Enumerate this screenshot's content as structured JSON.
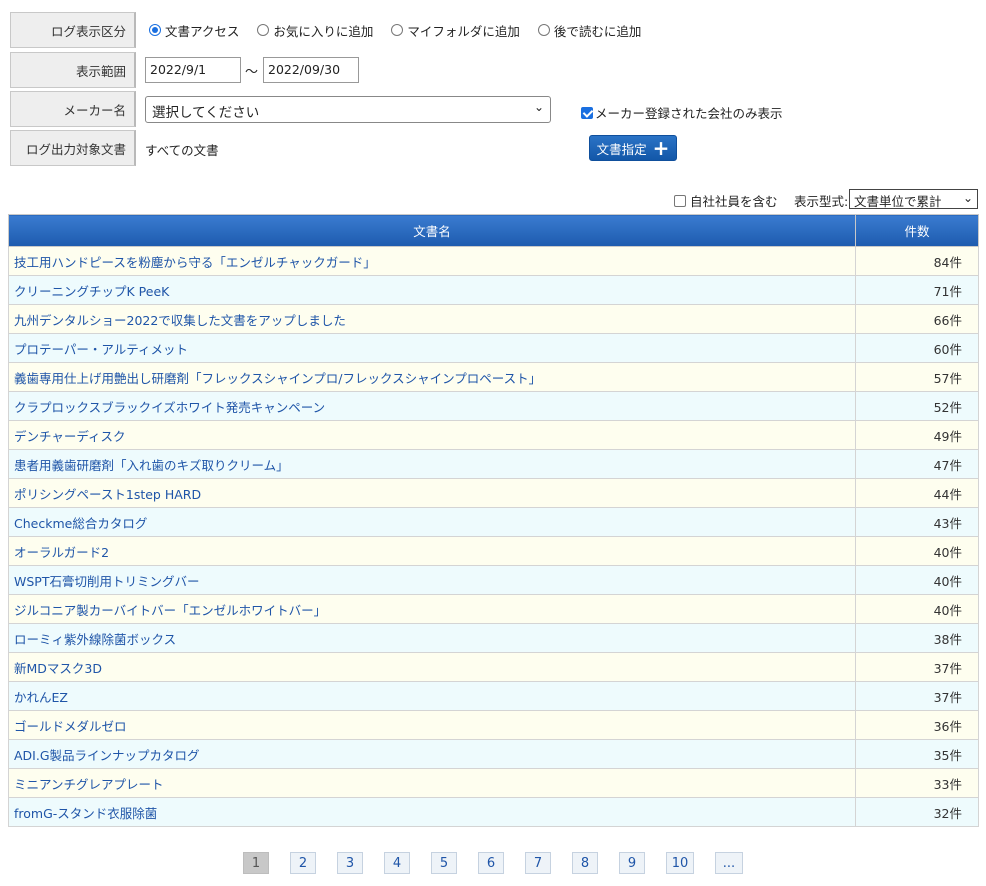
{
  "filters": {
    "log_type": {
      "label": "ログ表示区分",
      "options": [
        "文書アクセス",
        "お気に入りに追加",
        "マイフォルダに追加",
        "後で読むに追加"
      ],
      "selected": "文書アクセス"
    },
    "range": {
      "label": "表示範囲",
      "from": "2022/9/1",
      "separator": "～",
      "to": "2022/09/30"
    },
    "maker": {
      "label": "メーカー名",
      "value": "選択してください",
      "registered_only_label": "メーカー登録された会社のみ表示",
      "registered_only_checked": true
    },
    "target_docs": {
      "label": "ログ出力対象文書",
      "value": "すべての文書",
      "button_label": "文書指定"
    }
  },
  "options": {
    "include_staff_label": "自社社員を含む",
    "include_staff_checked": false,
    "display_type_label": "表示型式:",
    "display_type_value": "文書単位で累計"
  },
  "table": {
    "headers": [
      "文書名",
      "件数"
    ],
    "rows": [
      {
        "name": "技工用ハンドピースを粉塵から守る「エンゼルチャックガード」",
        "count": "84件"
      },
      {
        "name": "クリーニングチップK PeeK",
        "count": "71件"
      },
      {
        "name": "九州デンタルショー2022で収集した文書をアップしました",
        "count": "66件"
      },
      {
        "name": "プロテーパー・アルティメット",
        "count": "60件"
      },
      {
        "name": "義歯専用仕上げ用艶出し研磨剤「フレックスシャインプロ/フレックスシャインプロペースト」",
        "count": "57件"
      },
      {
        "name": "クラプロックスブラックイズホワイト発売キャンペーン",
        "count": "52件"
      },
      {
        "name": "デンチャーディスク",
        "count": "49件"
      },
      {
        "name": "患者用義歯研磨剤「入れ歯のキズ取りクリーム」",
        "count": "47件"
      },
      {
        "name": "ポリシングペースト1step HARD",
        "count": "44件"
      },
      {
        "name": "Checkme総合カタログ",
        "count": "43件"
      },
      {
        "name": "オーラルガード2",
        "count": "40件"
      },
      {
        "name": "WSPT石膏切削用トリミングバー",
        "count": "40件"
      },
      {
        "name": "ジルコニア製カーバイトバー「エンゼルホワイトバー」",
        "count": "40件"
      },
      {
        "name": "ローミィ紫外線除菌ボックス",
        "count": "38件"
      },
      {
        "name": "新MDマスク3D",
        "count": "37件"
      },
      {
        "name": "かれんEZ",
        "count": "37件"
      },
      {
        "name": "ゴールドメダルゼロ",
        "count": "36件"
      },
      {
        "name": "ADI.G製品ラインナップカタログ",
        "count": "35件"
      },
      {
        "name": "ミニアンチグレアプレート",
        "count": "33件"
      },
      {
        "name": "fromG-スタンド衣服除菌",
        "count": "32件"
      }
    ]
  },
  "pagination": {
    "pages": [
      "1",
      "2",
      "3",
      "4",
      "5",
      "6",
      "7",
      "8",
      "9",
      "10",
      "..."
    ],
    "current": "1"
  }
}
